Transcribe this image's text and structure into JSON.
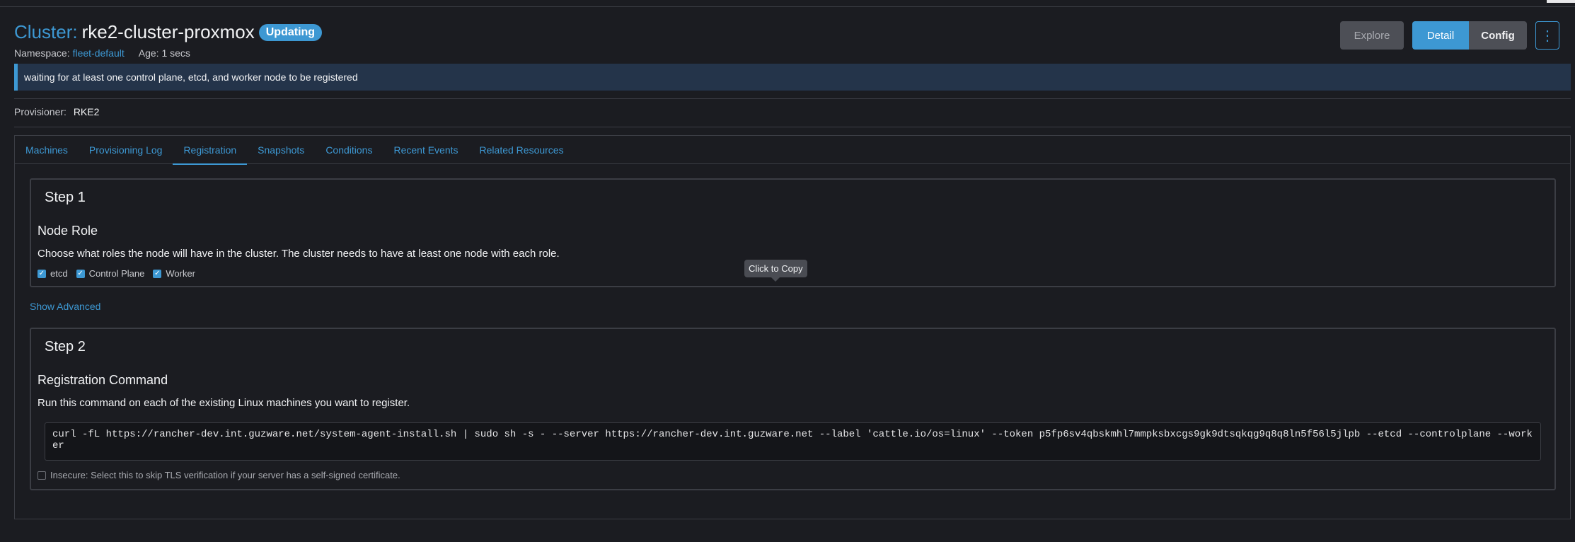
{
  "header": {
    "title_prefix": "Cluster:",
    "cluster_name": "rke2-cluster-proxmox",
    "status_badge": "Updating",
    "namespace_label": "Namespace:",
    "namespace_value": "fleet-default",
    "age": "Age: 1 secs"
  },
  "actions": {
    "explore": "Explore",
    "detail": "Detail",
    "config": "Config",
    "more": "⋮"
  },
  "banner": {
    "message": "waiting for at least one control plane, etcd, and worker node to be registered"
  },
  "provisioner": {
    "label": "Provisioner:",
    "value": "RKE2"
  },
  "tabs": [
    {
      "label": "Machines",
      "active": false
    },
    {
      "label": "Provisioning Log",
      "active": false
    },
    {
      "label": "Registration",
      "active": true
    },
    {
      "label": "Snapshots",
      "active": false
    },
    {
      "label": "Conditions",
      "active": false
    },
    {
      "label": "Recent Events",
      "active": false
    },
    {
      "label": "Related Resources",
      "active": false
    }
  ],
  "step1": {
    "title": "Step 1",
    "section": "Node Role",
    "description": "Choose what roles the node will have in the cluster. The cluster needs to have at least one node with each role.",
    "roles": [
      {
        "label": "etcd",
        "checked": true
      },
      {
        "label": "Control Plane",
        "checked": true
      },
      {
        "label": "Worker",
        "checked": true
      }
    ]
  },
  "show_advanced": "Show Advanced",
  "step2": {
    "title": "Step 2",
    "section": "Registration Command",
    "description": "Run this command on each of the existing Linux machines you want to register.",
    "tooltip": "Click to Copy",
    "command": "curl -fL https://rancher-dev.int.guzware.net/system-agent-install.sh | sudo sh -s - --server https://rancher-dev.int.guzware.net --label 'cattle.io/os=linux' --token p5fp6sv4qbskmhl7mmpksbxcgs9gk9dtsqkqg9q8q8ln5f56l5jlpb --etcd --controlplane --worker",
    "insecure_label": "Insecure: Select this to skip TLS verification if your server has a self-signed certificate.",
    "insecure_checked": false
  },
  "colors": {
    "accent": "#3d98d3",
    "background": "#1b1c21",
    "banner_bg": "#24344a"
  }
}
